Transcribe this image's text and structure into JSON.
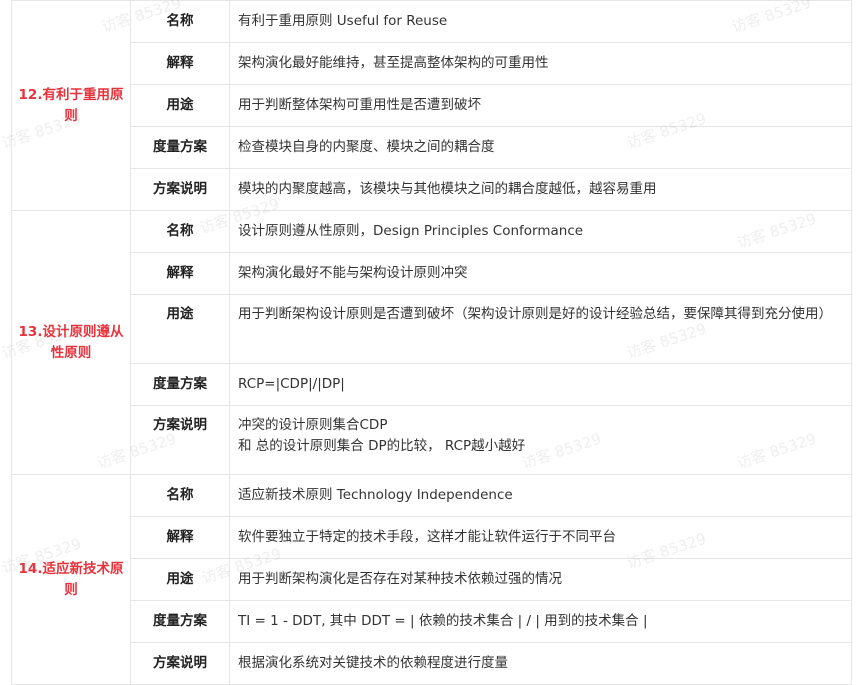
{
  "groups": [
    {
      "title": "12.有利于重用原则",
      "rows": [
        {
          "key": "名称",
          "value": "有利于重用原则 Useful for Reuse"
        },
        {
          "key": "解释",
          "value": "架构演化最好能维持，甚至提高整体架构的可重用性"
        },
        {
          "key": "用途",
          "value": "用于判断整体架构可重用性是否遭到破坏"
        },
        {
          "key": "度量方案",
          "value": "检查模块自身的内聚度、模块之间的耦合度"
        },
        {
          "key": "方案说明",
          "value": "模块的内聚度越高，该模块与其他模块之间的耦合度越低，越容易重用"
        }
      ]
    },
    {
      "title": "13.设计原则遵从性原则",
      "rows": [
        {
          "key": "名称",
          "value": "设计原则遵从性原则，Design Principles Conformance"
        },
        {
          "key": "解释",
          "value": "架构演化最好不能与架构设计原则冲突"
        },
        {
          "key": "用途",
          "value": "用于判断架构设计原则是否遭到破坏（架构设计原则是好的设计经验总结，要保障其得到充分使用）"
        },
        {
          "key": "度量方案",
          "value": "RCP=|CDP|/|DP|"
        },
        {
          "key": "方案说明",
          "value_line1": "冲突的设计原则集合CDP",
          "value_line2": "和 总的设计原则集合 DP的比较， RCP越小越好"
        }
      ]
    },
    {
      "title": "14.适应新技术原则",
      "rows": [
        {
          "key": "名称",
          "value": "适应新技术原则 Technology Independence"
        },
        {
          "key": "解释",
          "value": "软件要独立于特定的技术手段，这样才能让软件运行于不同平台"
        },
        {
          "key": "用途",
          "value": "用于判断架构演化是否存在对某种技术依赖过强的情况"
        },
        {
          "key": "度量方案",
          "value": "TI = 1 - DDT, 其中 DDT = | 依赖的技术集合 | / | 用到的技术集合 |"
        },
        {
          "key": "方案说明",
          "value": "根据演化系统对关键技术的依赖程度进行度量"
        }
      ]
    }
  ],
  "watermark": "访客 85329"
}
